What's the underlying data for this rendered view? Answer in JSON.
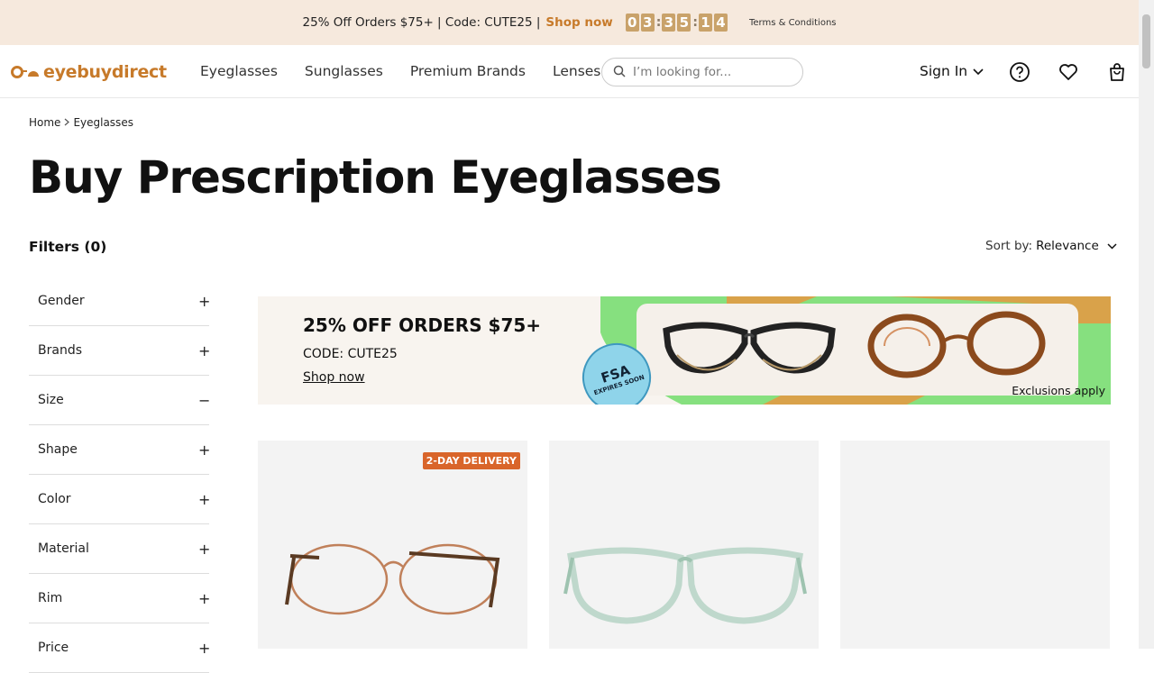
{
  "promo": {
    "text": "25% Off Orders $75+ | Code: CUTE25 |",
    "link": "Shop now",
    "countdown_digits": [
      "0",
      "3",
      "3",
      "5",
      "1",
      "4"
    ],
    "terms": "Terms & Conditions"
  },
  "header": {
    "logo_text": "eyebuydirect",
    "nav": [
      "Eyeglasses",
      "Sunglasses",
      "Premium Brands",
      "Lenses"
    ],
    "search_placeholder": "I’m looking for...",
    "sign_in": "Sign In",
    "icons": [
      "search-icon",
      "chevron-down-icon",
      "help-icon",
      "heart-icon",
      "bag-icon"
    ]
  },
  "breadcrumb": {
    "items": [
      "Home",
      "Eyeglasses"
    ]
  },
  "page": {
    "title": "Buy Prescription Eyeglasses"
  },
  "filters": {
    "title": "Filters (0)",
    "items": [
      {
        "label": "Gender",
        "sign": "+"
      },
      {
        "label": "Brands",
        "sign": "+"
      },
      {
        "label": "Size",
        "sign": "−"
      },
      {
        "label": "Shape",
        "sign": "+"
      },
      {
        "label": "Color",
        "sign": "+"
      },
      {
        "label": "Material",
        "sign": "+"
      },
      {
        "label": "Rim",
        "sign": "+"
      },
      {
        "label": "Price",
        "sign": "+"
      }
    ]
  },
  "sort": {
    "label": "Sort by:",
    "value": "Relevance"
  },
  "banner": {
    "headline": "25% OFF ORDERS $75+",
    "code": "CODE: CUTE25",
    "shop": "Shop now",
    "badge_big": "FSA",
    "badge_small": "EXPIRES SOON",
    "exclusions": "Exclusions apply"
  },
  "products": {
    "badge": "2-DAY DELIVERY"
  },
  "colors": {
    "accent": "#c77a2a",
    "promo_bg": "#f6e9dd",
    "badge_bg": "#d9652a"
  }
}
